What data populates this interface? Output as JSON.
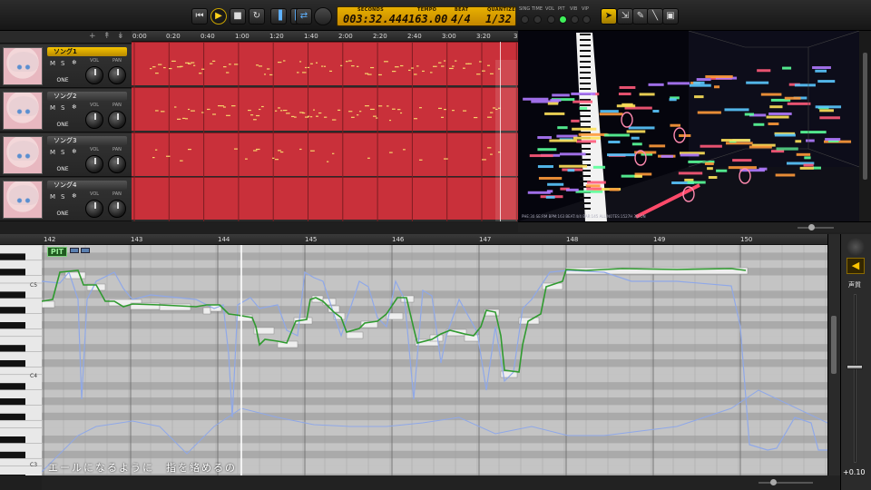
{
  "transport": {
    "seconds_caption": "SECONDS",
    "seconds": "003:32.444",
    "tempo_caption": "TEMPO",
    "tempo": "163.00",
    "beat_caption": "BEAT",
    "beat": "4/4",
    "quantize_caption": "QUANTIZE",
    "quantize": "1/32",
    "status_labels": [
      "SING",
      "TIME",
      "VOL",
      "PIT",
      "VIB",
      "VIP"
    ]
  },
  "tracks": {
    "header_icons": [
      "+",
      "↟",
      "↡"
    ],
    "items": [
      {
        "name": "ソング1",
        "selected": true
      },
      {
        "name": "ソング2",
        "selected": false
      },
      {
        "name": "ソング3",
        "selected": false
      },
      {
        "name": "ソング4",
        "selected": false
      }
    ],
    "mute_label": "M",
    "solo_label": "S",
    "freeze_label": "❄",
    "vol_label": "VOL",
    "pan_label": "PAN",
    "one_label": "ONE"
  },
  "arrangement": {
    "ticks": [
      "0:00",
      "0:20",
      "0:40",
      "1:00",
      "1:20",
      "1:40",
      "2:00",
      "2:20",
      "2:40",
      "3:00",
      "3:20",
      "3"
    ],
    "lane_color": "#c9303a"
  },
  "view3d": {
    "status": "PHE:30 SE:RM BPM:163 BEAT:4/4 BAR:145 ALL NOTES:1527H 3D:ON"
  },
  "pianoroll": {
    "measures": [
      "142",
      "143",
      "144",
      "145",
      "146",
      "147",
      "148",
      "149",
      "150"
    ],
    "octave_labels": [
      "C5",
      "C4",
      "C3"
    ],
    "pit_label": "PIT",
    "lyrics": "エールになるように　指を絡めるの"
  },
  "rightstrip": {
    "volume_label": "声質",
    "volume_value": "+0.10"
  },
  "colors": {
    "accent": "#f5c400",
    "track_lane": "#c9303a",
    "pitch_curve": "#2f9a2f",
    "dynamics_curve": "#8fa8e8"
  }
}
